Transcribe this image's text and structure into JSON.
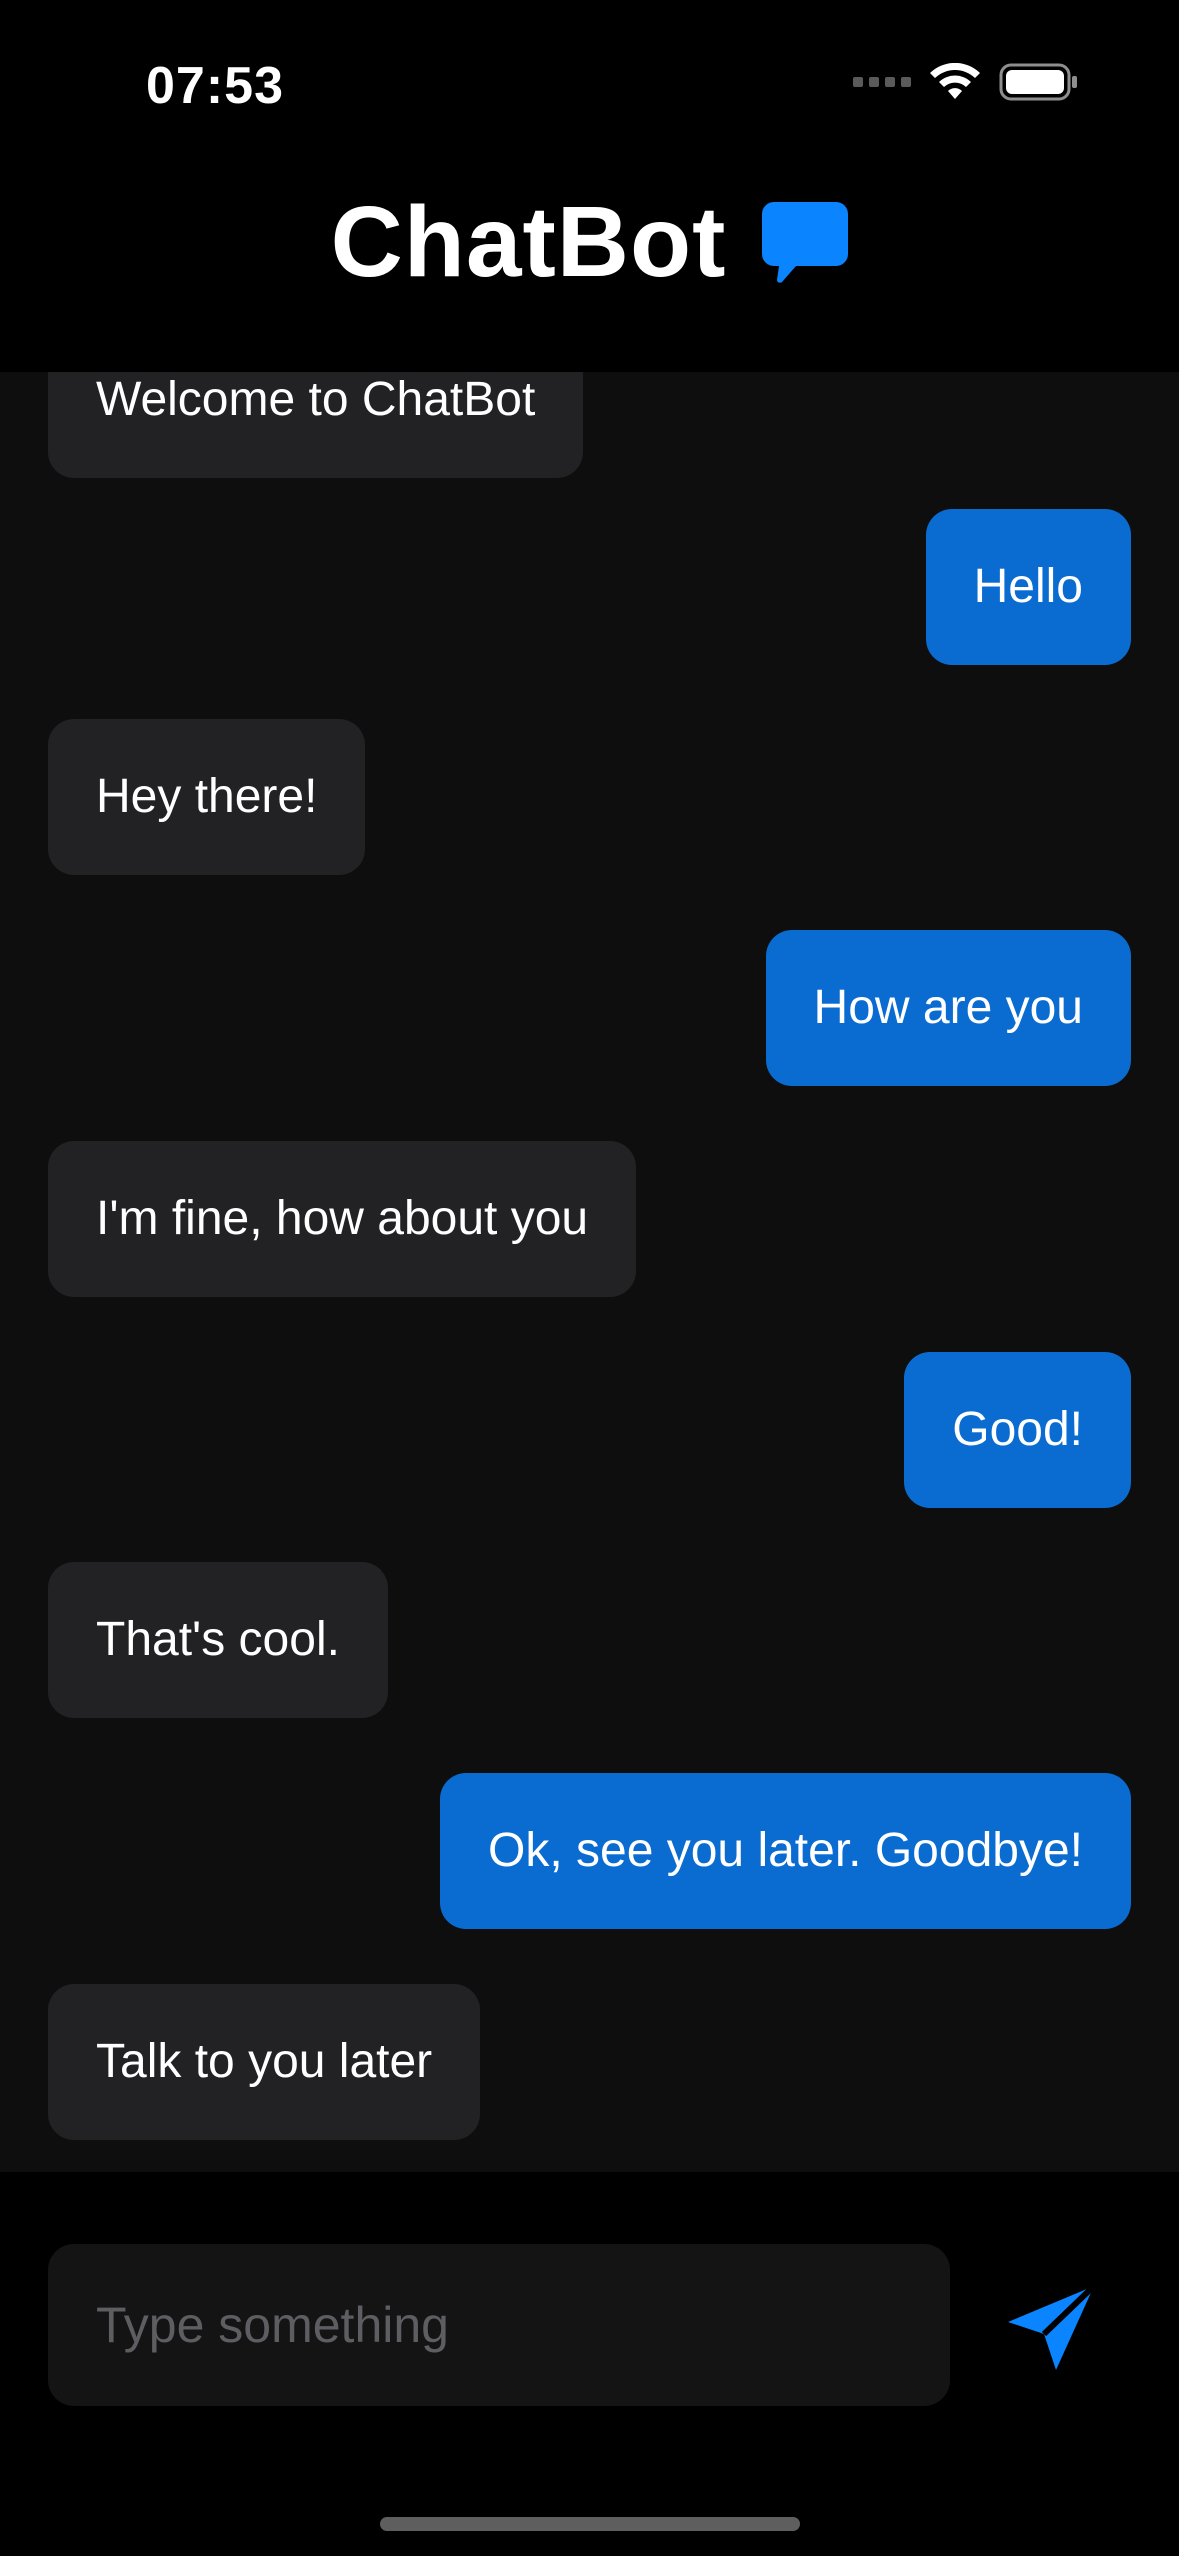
{
  "status_bar": {
    "time": "07:53",
    "icons": [
      "cellular-signal-icon",
      "wifi-icon",
      "battery-icon"
    ]
  },
  "header": {
    "title": "ChatBot",
    "icon": "chat-bubble-icon",
    "accent_color": "#0a84ff"
  },
  "messages": [
    {
      "sender": "bot",
      "text": "Welcome to ChatBot"
    },
    {
      "sender": "user",
      "text": "Hello"
    },
    {
      "sender": "bot",
      "text": "Hey there!"
    },
    {
      "sender": "user",
      "text": "How are you"
    },
    {
      "sender": "bot",
      "text": "I'm fine, how about you"
    },
    {
      "sender": "user",
      "text": "Good!"
    },
    {
      "sender": "bot",
      "text": "That's cool."
    },
    {
      "sender": "user",
      "text": "Ok, see you later. Goodbye!"
    },
    {
      "sender": "bot",
      "text": "Talk to you later"
    }
  ],
  "composer": {
    "value": "",
    "placeholder": "Type something",
    "send_icon": "send-paper-plane-icon"
  },
  "colors": {
    "user_bubble": "#0a6bd1",
    "bot_bubble": "#222224",
    "chat_background": "#0e0e0e"
  }
}
